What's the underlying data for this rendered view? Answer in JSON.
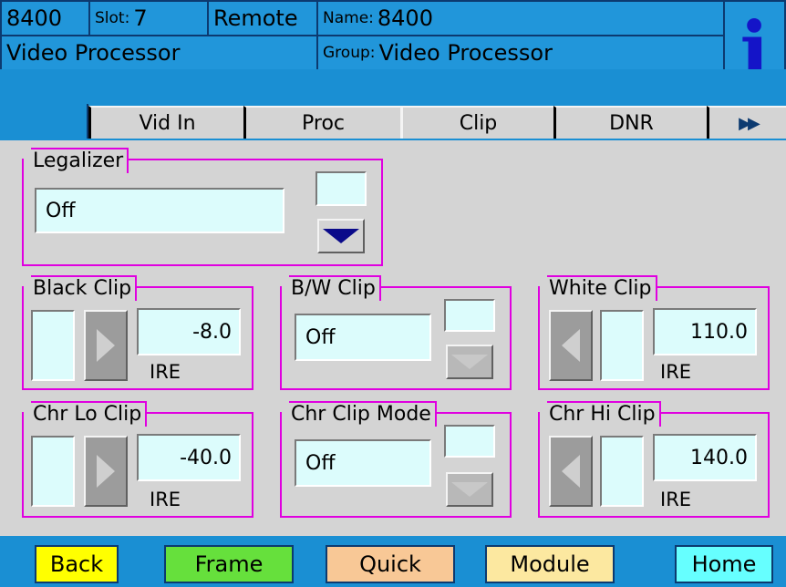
{
  "header": {
    "device": "8400",
    "slot_label": "Slot:",
    "slot_value": "7",
    "mode": "Remote",
    "name_label": "Name:",
    "name_value": "8400",
    "module_type": "Video Processor",
    "group_label": "Group:",
    "group_value": "Video Processor",
    "info_glyph": "i"
  },
  "tabs": [
    {
      "label": "Vid In"
    },
    {
      "label": "Proc"
    },
    {
      "label": "Clip",
      "selected": true
    },
    {
      "label": "DNR"
    },
    {
      "label": "▶▶"
    }
  ],
  "legalizer": {
    "title": "Legalizer",
    "value": "Off"
  },
  "black_clip": {
    "title": "Black Clip",
    "value": "-8.0",
    "unit": "IRE"
  },
  "bw_clip": {
    "title": "B/W Clip",
    "value": "Off"
  },
  "white_clip": {
    "title": "White Clip",
    "value": "110.0",
    "unit": "IRE"
  },
  "chr_lo_clip": {
    "title": "Chr Lo Clip",
    "value": "-40.0",
    "unit": "IRE"
  },
  "chr_clip_mode": {
    "title": "Chr Clip Mode",
    "value": "Off"
  },
  "chr_hi_clip": {
    "title": "Chr Hi Clip",
    "value": "140.0",
    "unit": "IRE"
  },
  "footer": {
    "back": "Back",
    "frame": "Frame",
    "quick": "Quick",
    "module": "Module",
    "home": "Home"
  },
  "colors": {
    "header_blue": "#1a8fd3",
    "group_border": "#e000e0",
    "field_bg": "#dcfcfc",
    "back_btn": "#ffff00",
    "frame_btn": "#66e03c",
    "quick_btn": "#f8c896",
    "module_btn": "#fce8a0",
    "home_btn": "#66ffff"
  }
}
